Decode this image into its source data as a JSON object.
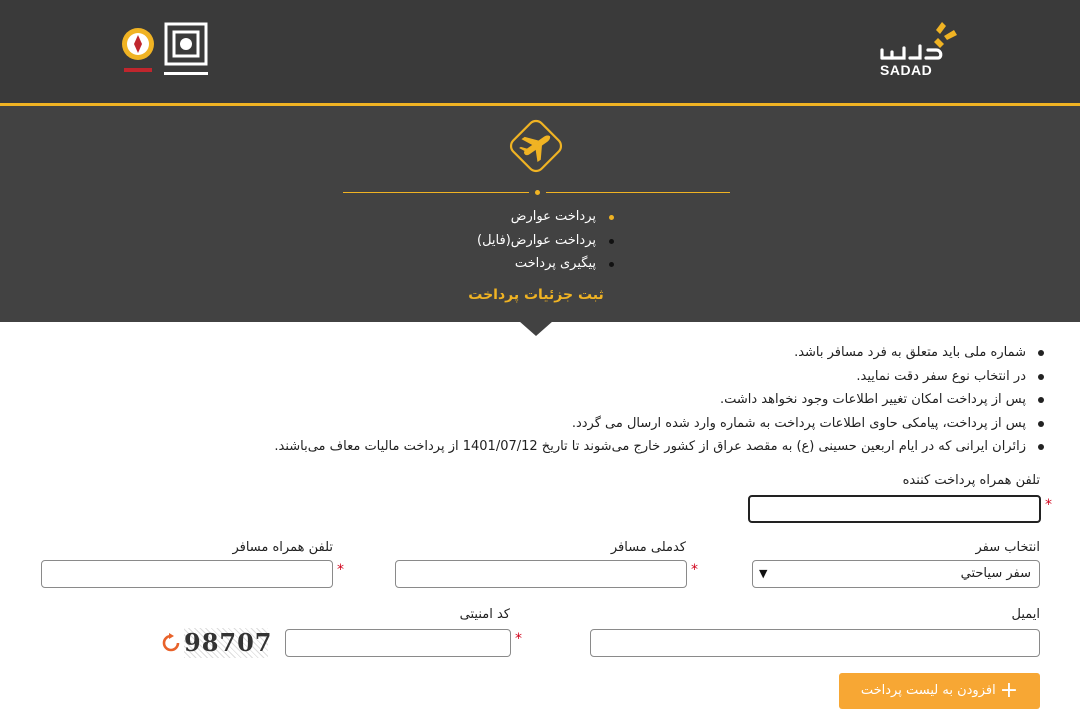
{
  "header": {
    "brand_text": "SADAD",
    "brand_fa": "سداد"
  },
  "menu": [
    {
      "label": "پرداخت عوارض",
      "active": true
    },
    {
      "label": "پرداخت عوارض(فایل)",
      "active": false
    },
    {
      "label": "پیگیری پرداخت",
      "active": false
    }
  ],
  "section_title": "ثبت جزئیات پرداخت",
  "notes": [
    "شماره ملی باید متعلق به فرد مسافر باشد.",
    "در انتخاب نوع سفر دقت نمایید.",
    "پس از پرداخت امکان تغییر اطلاعات وجود نخواهد داشت.",
    "پس از پرداخت، پیامکی حاوی اطلاعات پرداخت به شماره وارد شده ارسال می گردد.",
    "زائران ایرانی که در ایام اربعین حسینی (ع) به مقصد عراق از کشور خارج می‌شوند تا تاریخ 1401/07/12 از پرداخت مالیات معاف می‌باشند."
  ],
  "form": {
    "payer_phone_label": "تلفن همراه پرداخت کننده",
    "payer_phone_value": "",
    "trip_label": "انتخاب سفر",
    "trip_value": "سفر سیاحتي",
    "national_id_label": "کدملی مسافر",
    "national_id_value": "",
    "passenger_phone_label": "تلفن همراه مسافر",
    "passenger_phone_value": "",
    "email_label": "ایمیل",
    "email_value": "",
    "security_code_label": "کد امنیتی",
    "security_code_value": "",
    "captcha_text": "98707",
    "required_mark": "*"
  },
  "add_button_label": "افزودن به لیست پرداخت",
  "colors": {
    "accent": "#f0b323",
    "button": "#f7a734",
    "header_bg": "#3a3a3a",
    "section_bg": "#424242",
    "required": "#d0021b"
  }
}
